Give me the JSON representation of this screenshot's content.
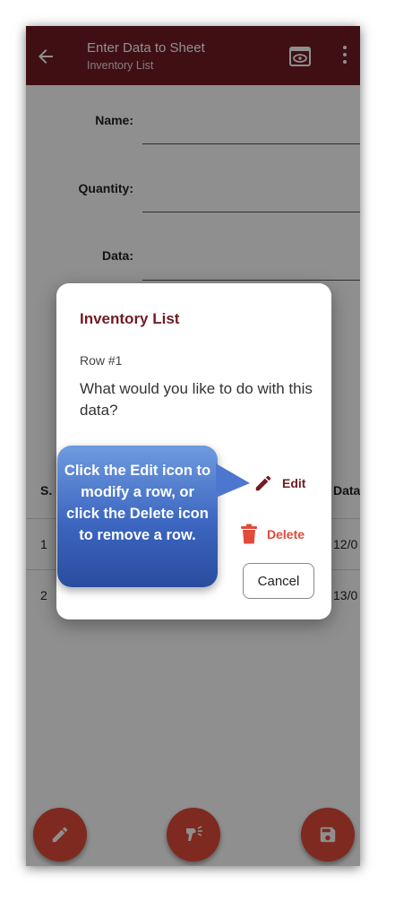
{
  "appbar": {
    "title": "Enter Data to Sheet",
    "subtitle": "Inventory List",
    "icons": [
      "back-arrow-icon",
      "preview-eye-icon",
      "more-vert-icon"
    ],
    "color": "#701c25"
  },
  "form": {
    "name_label": "Name:",
    "quantity_label": "Quantity:",
    "data_label": "Data:"
  },
  "table": {
    "columns": [
      "S.",
      "Data"
    ],
    "rows": [
      {
        "sno": "1",
        "date": "12/0"
      },
      {
        "sno": "2",
        "date": "13/0"
      }
    ]
  },
  "dialog": {
    "title": "Inventory List",
    "row": "Row #1",
    "question": "What would you like to do with this data?",
    "edit_label": "Edit",
    "delete_label": "Delete",
    "cancel_label": "Cancel"
  },
  "callout": {
    "text": "Click the Edit icon to modify a row, or click the Delete icon to remove a row."
  },
  "fabs": [
    "edit-icon",
    "barcode-scanner-icon",
    "save-icon"
  ],
  "colors": {
    "accent": "#e04b3a",
    "primary": "#701c25",
    "callout": "#3c66c0"
  }
}
